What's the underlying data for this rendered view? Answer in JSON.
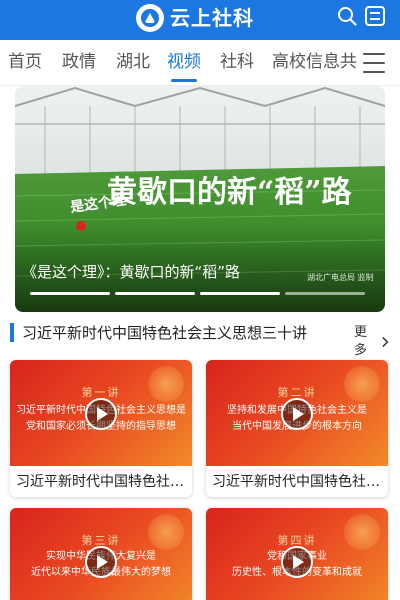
{
  "header": {
    "title": "云上社科",
    "accent_color": "#1c78e0",
    "search_icon": "search-icon",
    "profile_icon": "profile-card-icon"
  },
  "nav": {
    "tabs": [
      {
        "label": "首页",
        "active": false
      },
      {
        "label": "政情",
        "active": false
      },
      {
        "label": "湖北",
        "active": false
      },
      {
        "label": "视频",
        "active": true
      },
      {
        "label": "社科",
        "active": false
      },
      {
        "label": "高校信息共",
        "active": false
      }
    ],
    "menu_icon": "hamburger-menu-icon"
  },
  "banner": {
    "overlay_title": "黄歇口的新“稻”路",
    "logo_text": "是这个理",
    "caption": "《是这个理》：黄歇口的新“稻”路",
    "watermark": "湖北广电总局 监制",
    "slides": 4,
    "active_slide": 2
  },
  "section": {
    "title": "习近平新时代中国特色社会主义思想三十讲",
    "more_label": "更多",
    "more_icon": "chevron-right-icon"
  },
  "cards": [
    {
      "lecture": "第一讲",
      "line1": "习近平新时代中国特色社会主义思想是",
      "line2": "党和国家必须长期坚持的指导思想",
      "title": "习近平新时代中国特色社会主义思想..."
    },
    {
      "lecture": "第二讲",
      "line1": "坚持和发展中国特色社会主义是",
      "line2": "当代中国发展进步的根本方向",
      "title": "习近平新时代中国特色社会主义思想..."
    },
    {
      "lecture": "第三讲",
      "line1": "实现中华民族伟大复兴是",
      "line2": "近代以来中华民族最伟大的梦想",
      "title": ""
    },
    {
      "lecture": "第四讲",
      "line1": "党和国家事业",
      "line2": "历史性、根本性的变革和成就",
      "title": ""
    }
  ],
  "play_icon": "play-icon"
}
